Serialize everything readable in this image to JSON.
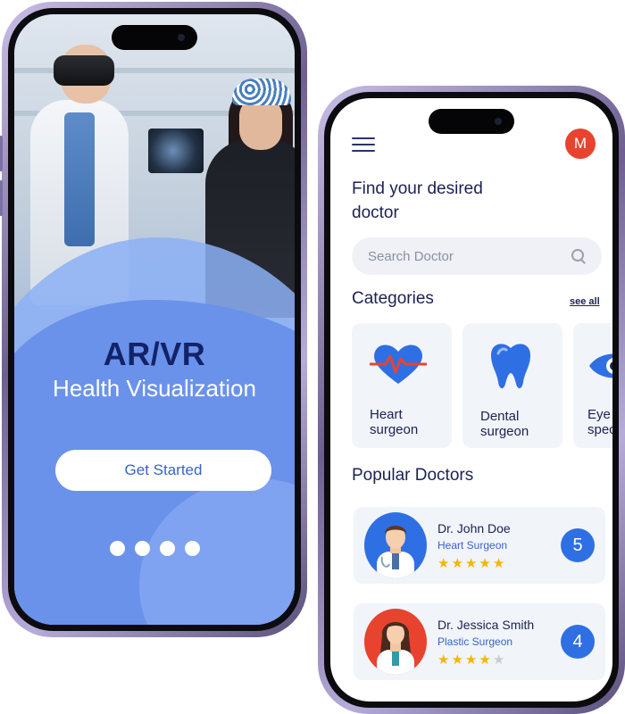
{
  "left_screen": {
    "hero_title": "AR/VR",
    "hero_subtitle": "Health Visualization",
    "cta_label": "Get Started",
    "page_indicator_count": 4
  },
  "right_screen": {
    "avatar_initial": "M",
    "heading": "Find your desired doctor",
    "search": {
      "placeholder": "Search Doctor"
    },
    "categories": {
      "title": "Categories",
      "see_all": "see all",
      "items": [
        {
          "label_line1": "Heart",
          "label_line2": "surgeon",
          "icon": "heart-pulse-icon"
        },
        {
          "label_line1": "Dental",
          "label_line2": "surgeon",
          "icon": "tooth-icon"
        },
        {
          "label_line1": "Eye",
          "label_line2": "spec",
          "icon": "eye-icon"
        }
      ]
    },
    "popular": {
      "title": "Popular Doctors",
      "doctors": [
        {
          "name": "Dr. John Doe",
          "specialty": "Heart Surgeon",
          "rating": 5,
          "badge": "5"
        },
        {
          "name": "Dr. Jessica Smith",
          "specialty": "Plastic Surgeon",
          "rating": 4,
          "badge": "4"
        }
      ]
    }
  },
  "colors": {
    "accent_blue": "#2f6fe4",
    "navy_text": "#1c2152",
    "avatar_red": "#e8432e",
    "star_gold": "#f7b500",
    "hero_blue": "#6f95ec"
  }
}
